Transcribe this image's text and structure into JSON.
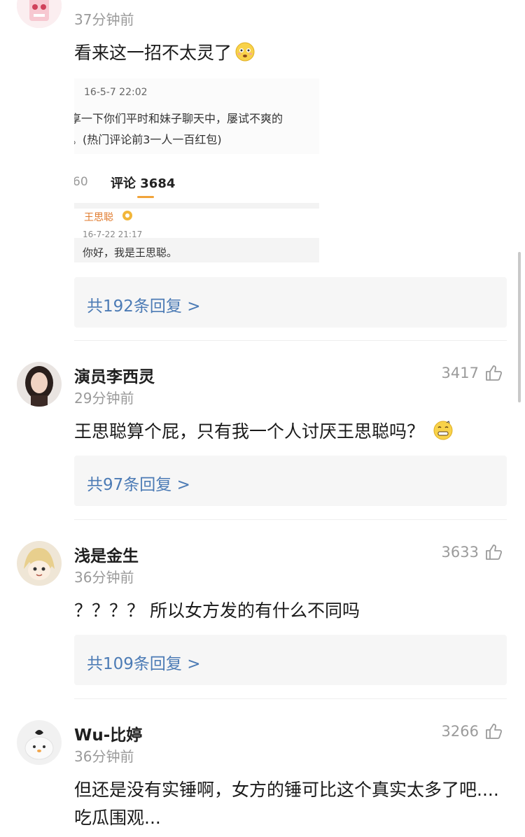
{
  "comments": [
    {
      "username": "",
      "time": "37分钟前",
      "text": "看来这一招不太灵了",
      "replies": "共192条回复 >",
      "embed": {
        "date1": "16-5-7 22:02",
        "line1": "享一下你们平时和妹子聊天中，屡试不爽的",
        "line2": "。(热门评论前3一人一百红包)",
        "tab_left": "60",
        "tab_active": "评论 3684",
        "name": "王思聪",
        "date2": "16-7-22 21:17",
        "reply": "你好，我是王思聪。"
      }
    },
    {
      "username": "演员李西灵",
      "time": "29分钟前",
      "likes": "3417",
      "text": "王思聪算个屁，只有我一个人讨厌王思聪吗？",
      "replies": "共97条回复 >"
    },
    {
      "username": "浅是金生",
      "time": "36分钟前",
      "likes": "3633",
      "text": "？？？？ 所以女方发的有什么不同吗",
      "replies": "共109条回复 >"
    },
    {
      "username": "Wu-比婷",
      "time": "36分钟前",
      "likes": "3266",
      "text": "但还是没有实锤啊，女方的锤可比这个真实太多了吧....吃瓜围观..."
    }
  ],
  "icons": {
    "like": "thumbs-up-icon",
    "emoji_flushed": "flushed-face-icon",
    "emoji_sleepy": "grimace-face-icon"
  },
  "colors": {
    "link": "#4c7bb5",
    "muted": "#9a9a9a",
    "reply_bg": "#f6f6f6"
  }
}
